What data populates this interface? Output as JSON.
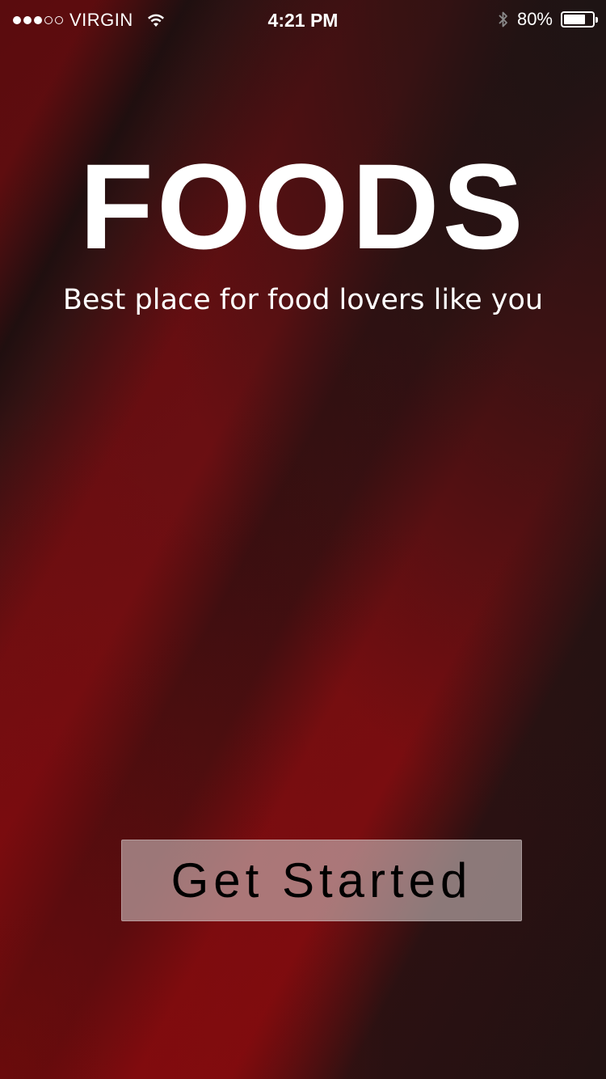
{
  "status_bar": {
    "signal_filled": 3,
    "signal_total": 5,
    "carrier": "VIRGIN",
    "time": "4:21 PM",
    "battery_text": "80%",
    "battery_level_fraction": 0.8,
    "icons": [
      "wifi-icon",
      "bluetooth-icon",
      "battery-icon"
    ]
  },
  "hero": {
    "title": "FOODS",
    "subtitle": "Best place for food lovers like you"
  },
  "cta": {
    "label": "Get Started"
  },
  "colors": {
    "background_red": "#6b0f12",
    "background_dark": "#1c1414",
    "text_white": "#ffffff",
    "button_fill": "#c8b9b9",
    "button_text": "#000000"
  }
}
